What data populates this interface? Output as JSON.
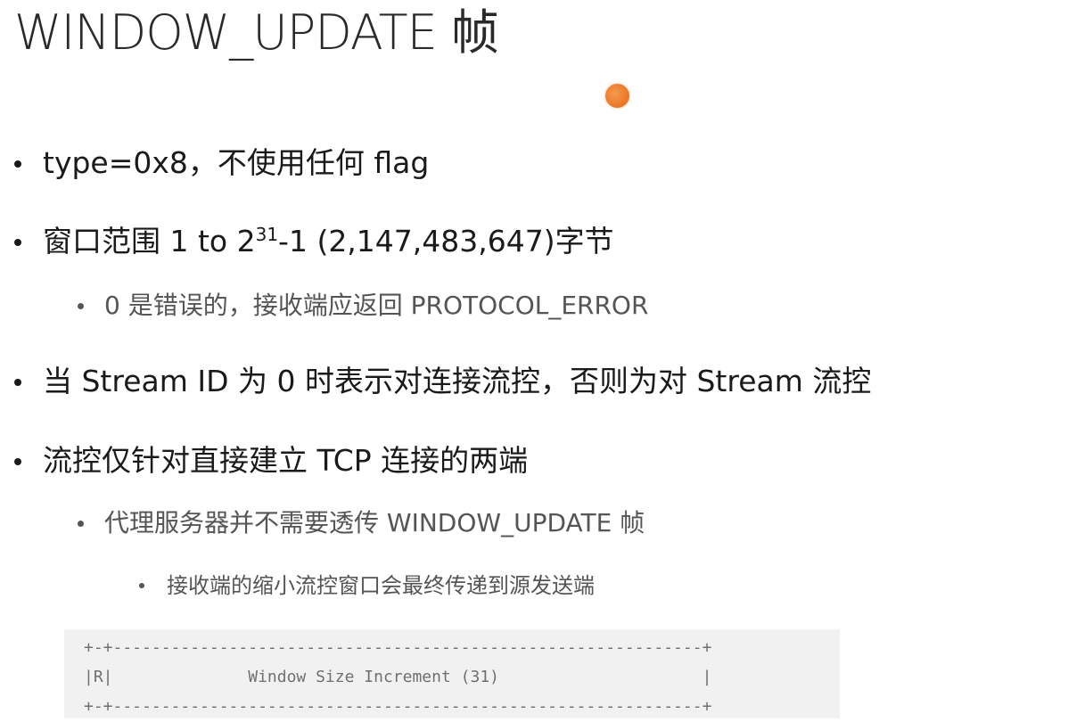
{
  "slide": {
    "title": "WINDOW_UPDATE 帧",
    "bullets": {
      "b1": "type=0x8，不使用任何 flag",
      "b2_prefix": "窗口范围 1 to 2",
      "b2_exponent": "31",
      "b2_suffix": "-1 (2,147,483,647)字节",
      "b2_sub1": "0 是错误的，接收端应返回 PROTOCOL_ERROR",
      "b3": "当 Stream ID 为 0 时表示对连接流控，否则为对 Stream 流控",
      "b4": "流控仅针对直接建立 TCP 连接的两端",
      "b4_sub1": "代理服务器并不需要透传 WINDOW_UPDATE 帧",
      "b4_sub1_sub1": "接收端的缩小流控窗口会最终传递到源发送端"
    },
    "frame_diagram": {
      "border_top": "+-+-------------------------------------------------------------+",
      "field_row": "|R|              Window Size Increment (31)                     |",
      "border_bottom": "+-+-------------------------------------------------------------+"
    }
  },
  "colors": {
    "pointer_dot": "#ec7a2a",
    "code_background": "#f1f1f1"
  }
}
